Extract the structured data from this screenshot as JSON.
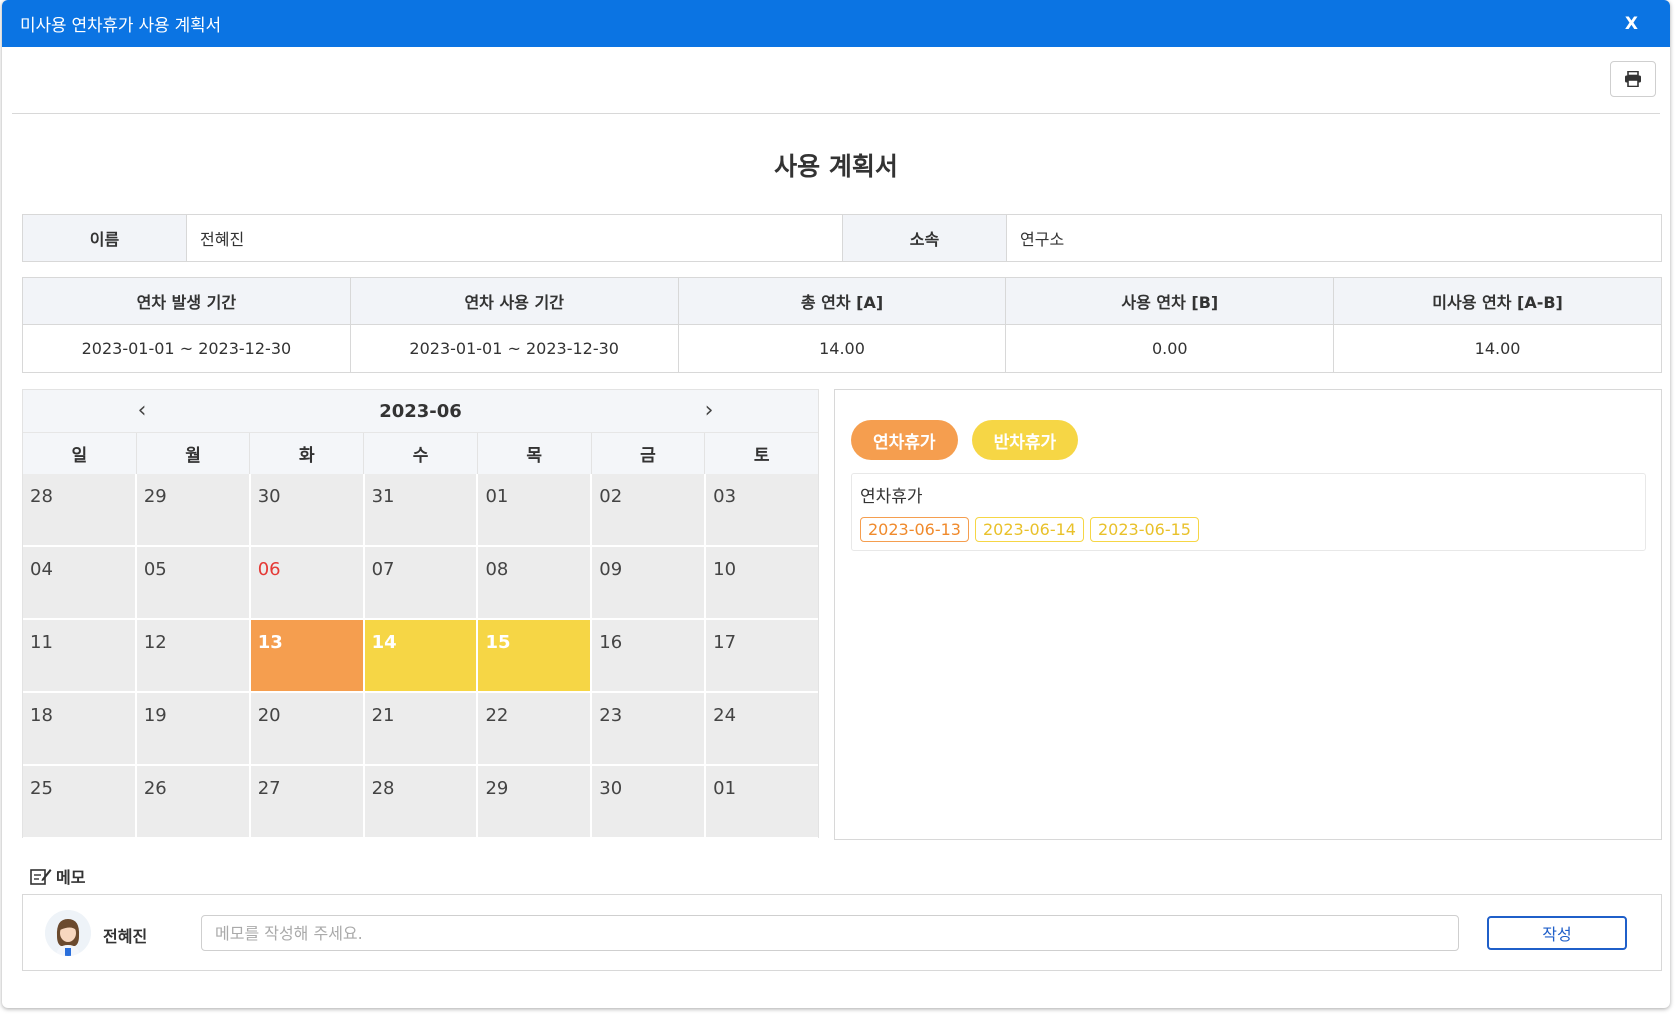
{
  "window": {
    "title": "미사용 연차휴가 사용 계획서",
    "close_label": "X"
  },
  "document": {
    "title": "사용 계획서"
  },
  "info": {
    "name_label": "이름",
    "name_value": "전혜진",
    "dept_label": "소속",
    "dept_value": "연구소"
  },
  "summary": {
    "headers": [
      "연차 발생 기간",
      "연차 사용 기간",
      "총 연차 [A]",
      "사용 연차 [B]",
      "미사용 연차 [A-B]"
    ],
    "values": [
      "2023-01-01 ~ 2023-12-30",
      "2023-01-01 ~ 2023-12-30",
      "14.00",
      "0.00",
      "14.00"
    ]
  },
  "calendar": {
    "prev_label": "‹",
    "next_label": "›",
    "month": "2023-06",
    "weekdays": [
      "일",
      "월",
      "화",
      "수",
      "목",
      "금",
      "토"
    ],
    "weeks": [
      [
        "28",
        "29",
        "30",
        "31",
        "01",
        "02",
        "03"
      ],
      [
        "04",
        "05",
        "06",
        "07",
        "08",
        "09",
        "10"
      ],
      [
        "11",
        "12",
        "13",
        "14",
        "15",
        "16",
        "17"
      ],
      [
        "18",
        "19",
        "20",
        "21",
        "22",
        "23",
        "24"
      ],
      [
        "25",
        "26",
        "27",
        "28",
        "29",
        "30",
        "01"
      ]
    ]
  },
  "legend": {
    "annual_label": "연차휴가",
    "half_label": "반차휴가"
  },
  "leave": {
    "label": "연차휴가",
    "dates": [
      "2023-06-13",
      "2023-06-14",
      "2023-06-15"
    ]
  },
  "memo": {
    "title": "메모",
    "author": "전혜진",
    "placeholder": "메모를 작성해 주세요.",
    "value": "",
    "submit_label": "작성"
  },
  "colors": {
    "brand": "#0b74e3",
    "annual": "#f59e4f",
    "half": "#f6d645",
    "holiday": "#e53935",
    "button": "#1f5fc9"
  }
}
